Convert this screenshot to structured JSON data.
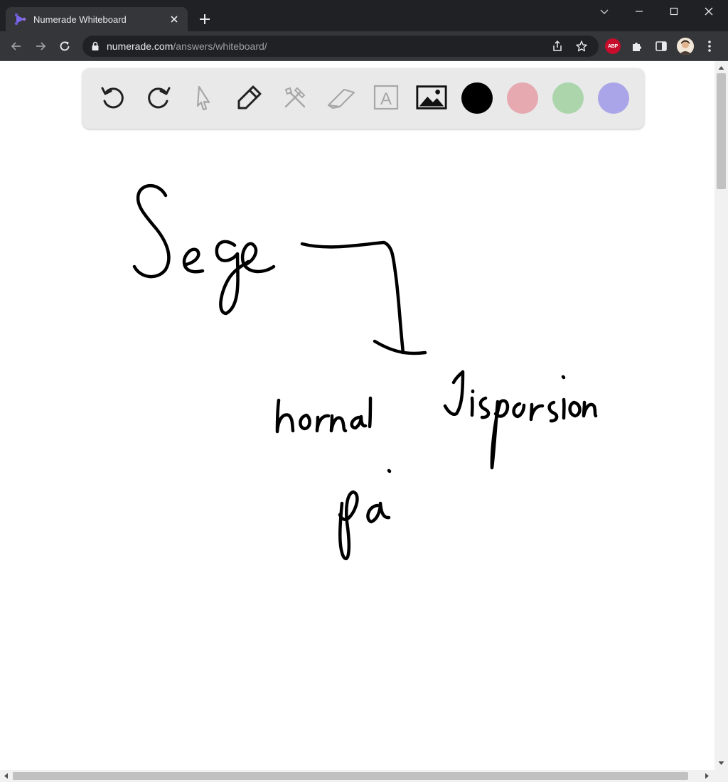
{
  "browser": {
    "tab_title": "Numerade Whiteboard",
    "url_host": "numerade.com",
    "url_path": "/answers/whiteboard/",
    "extension_abp_label": "ABP"
  },
  "whiteboard": {
    "tools": [
      {
        "name": "undo-icon"
      },
      {
        "name": "redo-icon"
      },
      {
        "name": "select-pointer-icon"
      },
      {
        "name": "pen-icon"
      },
      {
        "name": "tools-icon"
      },
      {
        "name": "eraser-icon"
      },
      {
        "name": "text-icon",
        "label": "A"
      },
      {
        "name": "image-icon"
      }
    ],
    "colors": {
      "black": "#000000",
      "pink": "#e6a9b0",
      "green": "#acd5ac",
      "lavender": "#aaa5e8"
    },
    "handwriting": [
      "Sege",
      "hornal",
      "dispersion",
      "pa"
    ]
  }
}
